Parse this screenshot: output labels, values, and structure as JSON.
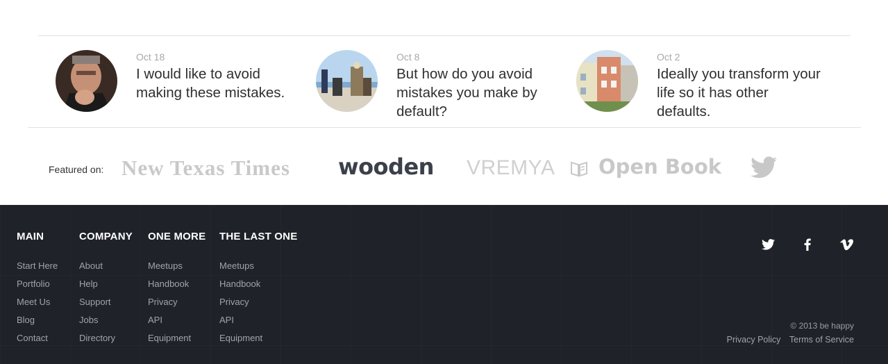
{
  "posts": [
    {
      "date": "Oct 18",
      "text": "I would like to avoid making these mistakes.",
      "avatar": "man-pointing-photo"
    },
    {
      "date": "Oct 8",
      "text": "But how do you avoid mistakes you make by default?",
      "avatar": "people-on-beach-photo"
    },
    {
      "date": "Oct 2",
      "text": "Ideally you transform your life so it has other defaults.",
      "avatar": "colorful-houses-photo"
    }
  ],
  "featured": {
    "label": "Featured on:",
    "logos": [
      "New Texas Times",
      "wooden",
      "VREMYA",
      "Open Book"
    ],
    "icons": [
      "open-book-icon",
      "twitter-bird-icon"
    ]
  },
  "footer": {
    "columns": [
      {
        "title": "MAIN",
        "links": [
          "Start Here",
          "Portfolio",
          "Meet Us",
          "Blog",
          "Contact"
        ]
      },
      {
        "title": "COMPANY",
        "links": [
          "About",
          "Help",
          "Support",
          "Jobs",
          "Directory"
        ]
      },
      {
        "title": "ONE MORE",
        "links": [
          "Meetups",
          "Handbook",
          "Privacy",
          "API",
          "Equipment"
        ]
      },
      {
        "title": "THE LAST ONE",
        "links": [
          "Meetups",
          "Handbook",
          "Privacy",
          "API",
          "Equipment"
        ]
      }
    ],
    "social": [
      "twitter-icon",
      "facebook-icon",
      "vimeo-icon"
    ],
    "copyright": "© 2013 be happy",
    "legal": [
      "Privacy Policy",
      "Terms of Service"
    ]
  },
  "colors": {
    "footer_bg": "#1f2228",
    "logo_gray": "#c2c2c2",
    "wooden_dark": "#3b404a"
  }
}
